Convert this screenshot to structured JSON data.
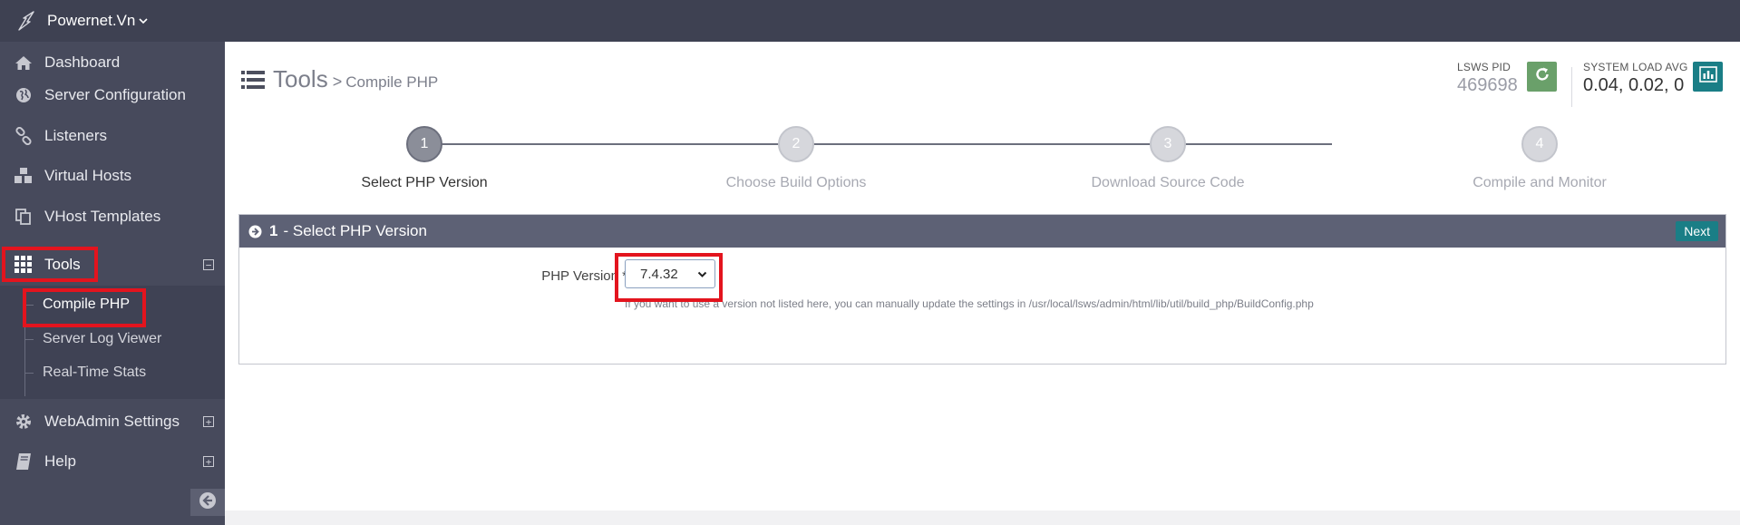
{
  "brand": {
    "name": "Powernet.Vn",
    "logo_icon": "lightning-logo-icon"
  },
  "sidebar": {
    "items": [
      {
        "label": "Dashboard",
        "icon": "home-icon"
      },
      {
        "label": "Server Configuration",
        "icon": "globe-icon"
      },
      {
        "label": "Listeners",
        "icon": "link-icon"
      },
      {
        "label": "Virtual Hosts",
        "icon": "cubes-icon"
      },
      {
        "label": "VHost Templates",
        "icon": "copy-icon"
      },
      {
        "label": "Tools",
        "icon": "grid-icon",
        "toggle": "⊟"
      },
      {
        "label": "WebAdmin Settings",
        "icon": "gear-icon",
        "toggle": "⊞"
      },
      {
        "label": "Help",
        "icon": "book-icon",
        "toggle": "⊞"
      }
    ],
    "tools_sub": [
      "Compile PHP",
      "Server Log Viewer",
      "Real-Time Stats"
    ]
  },
  "page": {
    "title": "Tools",
    "separator": ">",
    "subtitle": "Compile PHP"
  },
  "stats": {
    "pid_label": "LSWS PID",
    "pid_value": "469698",
    "load_label": "SYSTEM LOAD AVG",
    "load_value": "0.04, 0.02, 0"
  },
  "wizard": {
    "steps": [
      {
        "num": "1",
        "label": "Select PHP Version",
        "active": true
      },
      {
        "num": "2",
        "label": "Choose Build Options",
        "active": false
      },
      {
        "num": "3",
        "label": "Download Source Code",
        "active": false
      },
      {
        "num": "4",
        "label": "Compile and Monitor",
        "active": false
      }
    ]
  },
  "panel": {
    "step_num": "1",
    "title": "- Select PHP Version",
    "next_label": "Next",
    "field_label": "PHP Version *",
    "selected_version": "7.4.32",
    "help_text": "If you want to use a version not listed here, you can manually update the settings in /usr/local/lsws/admin/html/lib/util/build_php/BuildConfig.php"
  },
  "colors": {
    "topbar": "#3e4152",
    "sidebar": "#474a5c",
    "panel_header": "#5d6175",
    "highlight": "#e3141e",
    "refresh_button": "#6aa06a",
    "chart_button": "#1a7e86"
  }
}
